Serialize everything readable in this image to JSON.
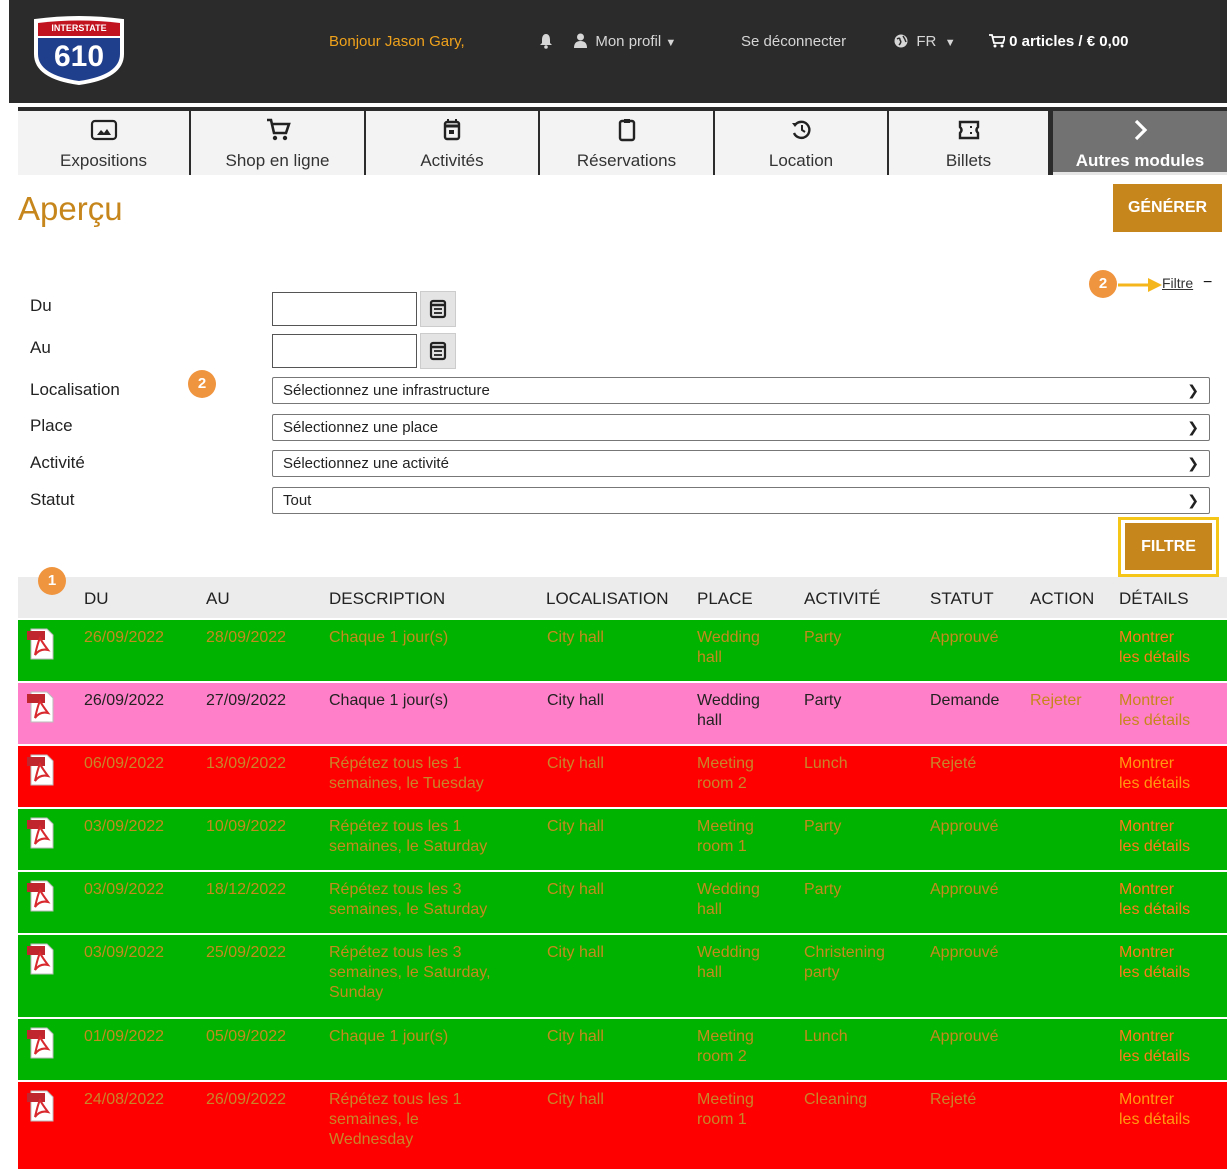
{
  "header": {
    "logo_text": "610",
    "logo_banner": "INTERSTATE",
    "greeting": "Bonjour Jason Gary,",
    "profile": "Mon profil",
    "logout": "Se déconnecter",
    "language": "FR",
    "cart": "0 articles / € 0,00"
  },
  "nav": [
    {
      "label": "Expositions",
      "icon": "image-icon"
    },
    {
      "label": "Shop en ligne",
      "icon": "cart-icon"
    },
    {
      "label": "Activités",
      "icon": "calendar-icon"
    },
    {
      "label": "Réservations",
      "icon": "clipboard-icon"
    },
    {
      "label": "Location",
      "icon": "history-icon"
    },
    {
      "label": "Billets",
      "icon": "ticket-icon"
    },
    {
      "label": "Autres modules",
      "icon": "chevron-right-icon"
    }
  ],
  "page": {
    "title": "Aperçu",
    "generate": "GÉNÉRER",
    "filter_link": "Filtre",
    "filter_dash": "−",
    "filter_button": "FILTRE",
    "badge1": "1",
    "badge2": "2"
  },
  "filters": {
    "from_label": "Du",
    "to_label": "Au",
    "location_label": "Localisation",
    "location_value": "Sélectionnez une infrastructure",
    "place_label": "Place",
    "place_value": "Sélectionnez une place",
    "activity_label": "Activité",
    "activity_value": "Sélectionnez une activité",
    "status_label": "Statut",
    "status_value": "Tout"
  },
  "colors": {
    "accent": "#c7861b",
    "approved": "#00b300",
    "request": "#ff80c8",
    "rejected": "#ff0000"
  },
  "table": {
    "headers": [
      "DU",
      "AU",
      "DESCRIPTION",
      "LOCALISATION",
      "PLACE",
      "ACTIVITÉ",
      "STATUT",
      "ACTION",
      "DÉTAILS"
    ],
    "rows": [
      {
        "status": "approved",
        "du": "26/09/2022",
        "au": "28/09/2022",
        "desc": [
          "Chaque 1 jour(s)"
        ],
        "loc": "City hall",
        "place": [
          "Wedding",
          "hall"
        ],
        "act": [
          "Party"
        ],
        "statut": "Approuvé",
        "action": "",
        "details": [
          "Montrer",
          "les détails"
        ]
      },
      {
        "status": "request",
        "du": "26/09/2022",
        "au": "27/09/2022",
        "desc": [
          "Chaque 1 jour(s)"
        ],
        "loc": "City hall",
        "place": [
          "Wedding",
          "hall"
        ],
        "act": [
          "Party"
        ],
        "statut": "Demande",
        "action": "Rejeter",
        "details": [
          "Montrer",
          "les détails"
        ]
      },
      {
        "status": "rejected",
        "du": "06/09/2022",
        "au": "13/09/2022",
        "desc": [
          "Répétez tous les 1",
          "semaines, le Tuesday"
        ],
        "loc": "City hall",
        "place": [
          "Meeting",
          "room 2"
        ],
        "act": [
          "Lunch"
        ],
        "statut": "Rejeté",
        "action": "",
        "details": [
          "Montrer",
          "les détails"
        ]
      },
      {
        "status": "approved",
        "du": "03/09/2022",
        "au": "10/09/2022",
        "desc": [
          "Répétez tous les 1",
          "semaines, le Saturday"
        ],
        "loc": "City hall",
        "place": [
          "Meeting",
          "room 1"
        ],
        "act": [
          "Party"
        ],
        "statut": "Approuvé",
        "action": "",
        "details": [
          "Montrer",
          "les détails"
        ]
      },
      {
        "status": "approved",
        "du": "03/09/2022",
        "au": "18/12/2022",
        "desc": [
          "Répétez tous les 3",
          "semaines, le Saturday"
        ],
        "loc": "City hall",
        "place": [
          "Wedding",
          "hall"
        ],
        "act": [
          "Party"
        ],
        "statut": "Approuvé",
        "action": "",
        "details": [
          "Montrer",
          "les détails"
        ]
      },
      {
        "status": "approved",
        "du": "03/09/2022",
        "au": "25/09/2022",
        "desc": [
          "Répétez tous les 3",
          "semaines, le Saturday,",
          "Sunday"
        ],
        "loc": "City hall",
        "place": [
          "Wedding",
          "hall"
        ],
        "act": [
          "Christening",
          "party"
        ],
        "statut": "Approuvé",
        "action": "",
        "details": [
          "Montrer",
          "les détails"
        ]
      },
      {
        "status": "approved",
        "du": "01/09/2022",
        "au": "05/09/2022",
        "desc": [
          "Chaque 1 jour(s)"
        ],
        "loc": "City hall",
        "place": [
          "Meeting",
          "room 2"
        ],
        "act": [
          "Lunch"
        ],
        "statut": "Approuvé",
        "action": "",
        "details": [
          "Montrer",
          "les détails"
        ]
      },
      {
        "status": "rejected",
        "du": "24/08/2022",
        "au": "26/09/2022",
        "desc": [
          "Répétez tous les 1",
          "semaines, le",
          "Wednesday"
        ],
        "loc": "City hall",
        "place": [
          "Meeting",
          "room 1"
        ],
        "act": [
          "Cleaning"
        ],
        "statut": "Rejeté",
        "action": "",
        "details": [
          "Montrer",
          "les détails"
        ]
      }
    ]
  }
}
